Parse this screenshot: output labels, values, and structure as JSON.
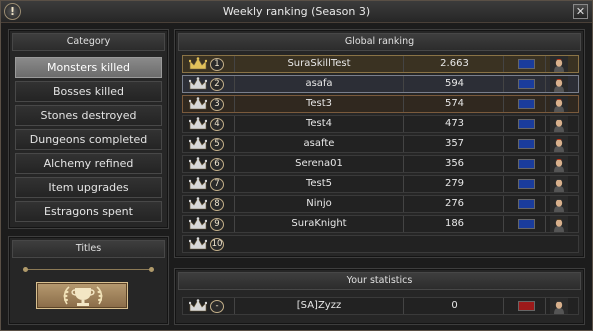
{
  "window": {
    "title": "Weekly ranking (Season 3)",
    "info_glyph": "!",
    "close_glyph": "✕"
  },
  "category": {
    "header": "Category",
    "items": [
      {
        "label": "Monsters killed",
        "active": true
      },
      {
        "label": "Bosses killed",
        "active": false
      },
      {
        "label": "Stones destroyed",
        "active": false
      },
      {
        "label": "Dungeons completed",
        "active": false
      },
      {
        "label": "Alchemy refined",
        "active": false
      },
      {
        "label": "Item upgrades",
        "active": false
      },
      {
        "label": "Estragons spent",
        "active": false
      }
    ]
  },
  "titles": {
    "header": "Titles",
    "button_icon": "trophy-laurel-icon"
  },
  "global_ranking": {
    "header": "Global ranking",
    "rows": [
      {
        "rank": "1",
        "name": "SuraSkillTest",
        "score": "2.663",
        "flag_color": "#1a3c9c",
        "avatar": "sura"
      },
      {
        "rank": "2",
        "name": "asafa",
        "score": "594",
        "flag_color": "#1a3c9c",
        "avatar": "sura"
      },
      {
        "rank": "3",
        "name": "Test3",
        "score": "574",
        "flag_color": "#1a3c9c",
        "avatar": "sura"
      },
      {
        "rank": "4",
        "name": "Test4",
        "score": "473",
        "flag_color": "#1a3c9c",
        "avatar": "ninja"
      },
      {
        "rank": "5",
        "name": "asafte",
        "score": "357",
        "flag_color": "#1a3c9c",
        "avatar": "sura"
      },
      {
        "rank": "6",
        "name": "Serena01",
        "score": "356",
        "flag_color": "#1a3c9c",
        "avatar": "sura"
      },
      {
        "rank": "7",
        "name": "Test5",
        "score": "279",
        "flag_color": "#1a3c9c",
        "avatar": "ninja"
      },
      {
        "rank": "8",
        "name": "Ninjo",
        "score": "276",
        "flag_color": "#1a3c9c",
        "avatar": "ninja"
      },
      {
        "rank": "9",
        "name": "SuraKnight",
        "score": "186",
        "flag_color": "#1a3c9c",
        "avatar": "warrior"
      },
      {
        "rank": "10",
        "name": "",
        "score": "",
        "flag_color": "",
        "avatar": ""
      }
    ]
  },
  "your_statistics": {
    "header": "Your statistics",
    "row": {
      "rank": "-",
      "name": "[SA]Zyzz",
      "score": "0",
      "flag_color": "#9c1a1a",
      "avatar": "ninja"
    }
  },
  "colors": {
    "gold_crown": "#e2c25a",
    "silver_crown": "#d8d8d8",
    "active_category": "#7c7c7c",
    "border_accent": "#8a7346"
  }
}
